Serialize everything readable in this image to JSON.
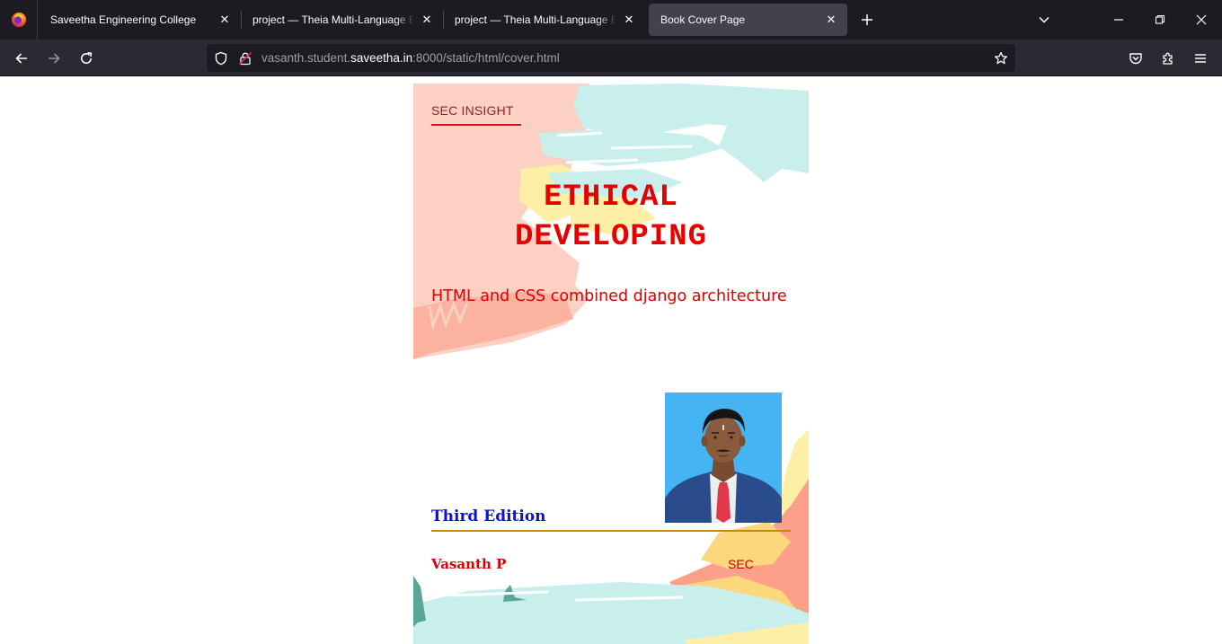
{
  "browser": {
    "tabs": [
      {
        "label": "Saveetha Engineering College",
        "active": false
      },
      {
        "label": "project — Theia Multi-Language Exa",
        "active": false
      },
      {
        "label": "project — Theia Multi-Language Exa",
        "active": false
      },
      {
        "label": "Book Cover Page",
        "active": true
      }
    ],
    "url": {
      "prefix": "vasanth.student.",
      "host": "saveetha.in",
      "suffix": ":8000/static/html/cover.html"
    }
  },
  "cover": {
    "series": "SEC INSIGHT",
    "title_line1": "ETHICAL",
    "title_line2": "DEVELOPING",
    "subtitle": "HTML and CSS combined django architecture",
    "edition": "Third Edition",
    "author": "Vasanth P",
    "publisher": "SEC"
  },
  "colors": {
    "title": "#e60000",
    "edition": "#0a12d6",
    "rule": "#c88a00",
    "paint_pink": "#fdd0c4",
    "paint_salmon": "#fbb3a0",
    "paint_teal": "#c9efec",
    "paint_yellow": "#fdf0a6",
    "paint_orange": "#fdd77b",
    "photo_bg": "#45b4f3",
    "suit": "#2b4c8c"
  }
}
